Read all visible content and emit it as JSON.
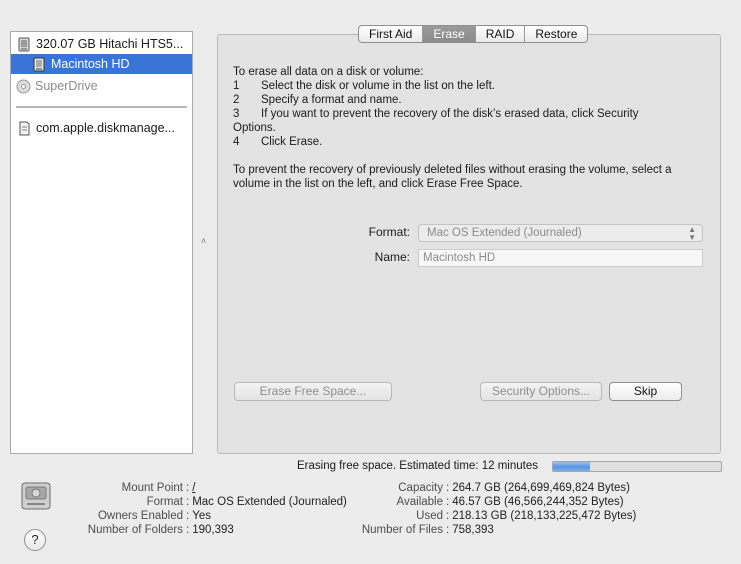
{
  "sidebar": {
    "items": [
      {
        "label": "320.07 GB Hitachi HTS5...",
        "icon": "hard-drive-icon"
      },
      {
        "label": "Macintosh HD",
        "icon": "volume-icon",
        "selected": true
      },
      {
        "label": "SuperDrive",
        "icon": "optical-drive-icon",
        "dimmed": true
      },
      {
        "label": "com.apple.diskmanage...",
        "icon": "disk-image-icon"
      }
    ]
  },
  "tabs": [
    "First Aid",
    "Erase",
    "RAID",
    "Restore"
  ],
  "active_tab": "Erase",
  "instructions": {
    "intro": "To erase all data on a disk or volume:",
    "steps": [
      {
        "num": "1",
        "text": "Select the disk or volume in the list on the left."
      },
      {
        "num": "2",
        "text": "Specify a format and name."
      },
      {
        "num": "3",
        "text": "If you want to prevent the recovery of the disk’s erased data, click Security"
      },
      {
        "num": "",
        "text": "Options."
      },
      {
        "num": "4",
        "text": "Click Erase."
      }
    ],
    "free_space_line1": "To prevent the recovery of previously deleted files without erasing the volume, select a",
    "free_space_line2": "volume in the list on the left, and click Erase Free Space."
  },
  "form": {
    "format_label": "Format:",
    "format_value": "Mac OS Extended (Journaled)",
    "name_label": "Name:",
    "name_value": "Macintosh HD"
  },
  "buttons": {
    "erase_free_space": "Erase Free Space...",
    "security_options": "Security Options...",
    "skip": "Skip"
  },
  "progress": {
    "text": "Erasing free space. Estimated time: 12 minutes",
    "fraction": 0.22
  },
  "info": {
    "left": [
      {
        "key": "Mount Point",
        "value": "/",
        "link": true
      },
      {
        "key": "Format",
        "value": "Mac OS Extended (Journaled)"
      },
      {
        "key": "Owners Enabled",
        "value": "Yes"
      },
      {
        "key": "Number of Folders",
        "value": "190,393"
      }
    ],
    "right": [
      {
        "key": "Capacity",
        "value": "264.7 GB (264,699,469,824 Bytes)"
      },
      {
        "key": "Available",
        "value": "46.57 GB (46,566,244,352 Bytes)"
      },
      {
        "key": "Used",
        "value": "218.13 GB (218,133,225,472 Bytes)"
      },
      {
        "key": "Number of Files",
        "value": "758,393"
      }
    ],
    "separator": ":"
  },
  "help_label": "?",
  "colors": {
    "selection": "#3875d7",
    "progress": "#5a94e1",
    "link": "#2a4fc2"
  }
}
